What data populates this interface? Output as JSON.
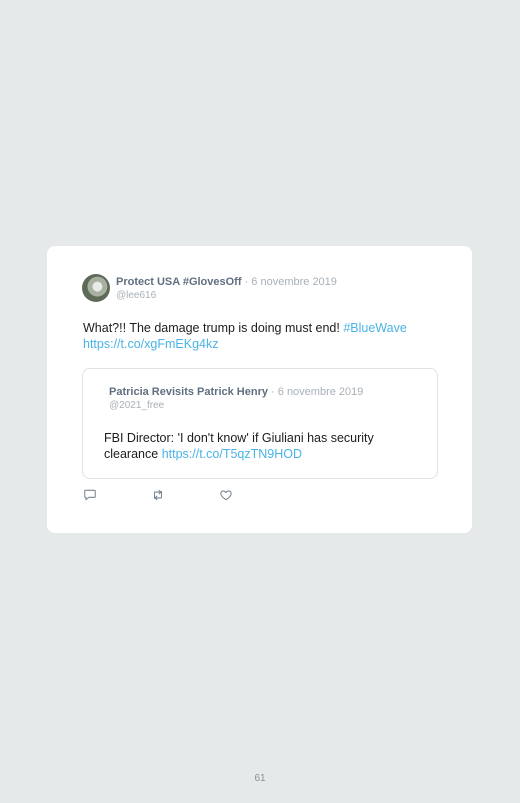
{
  "tweet": {
    "author_name": "Protect USA #GlovesOff",
    "separator": " · ",
    "date": "6 novembre 2019",
    "handle": "@lee616",
    "text": "What?!! The damage trump is doing must end! ",
    "hashtag": "#BlueWave",
    "link": "https://t.co/xgFmEKg4kz"
  },
  "quoted": {
    "author_name": "Patricia Revisits Patrick Henry",
    "separator": " · ",
    "date": "6 novembre 2019",
    "handle": "@2021_free",
    "text": "FBI Director: 'I don't know' if Giuliani has security clearance ",
    "link": "https://t.co/T5qzTN9HOD"
  },
  "actions": {
    "reply_icon": "reply-icon",
    "retweet_icon": "retweet-icon",
    "like_icon": "like-icon"
  },
  "page_number": "61",
  "colors": {
    "background": "#e6e9ea",
    "card": "#ffffff",
    "name": "#5f6f80",
    "muted": "#a8b0b8",
    "link": "#4ab3e6",
    "text": "#1c1c1c"
  }
}
